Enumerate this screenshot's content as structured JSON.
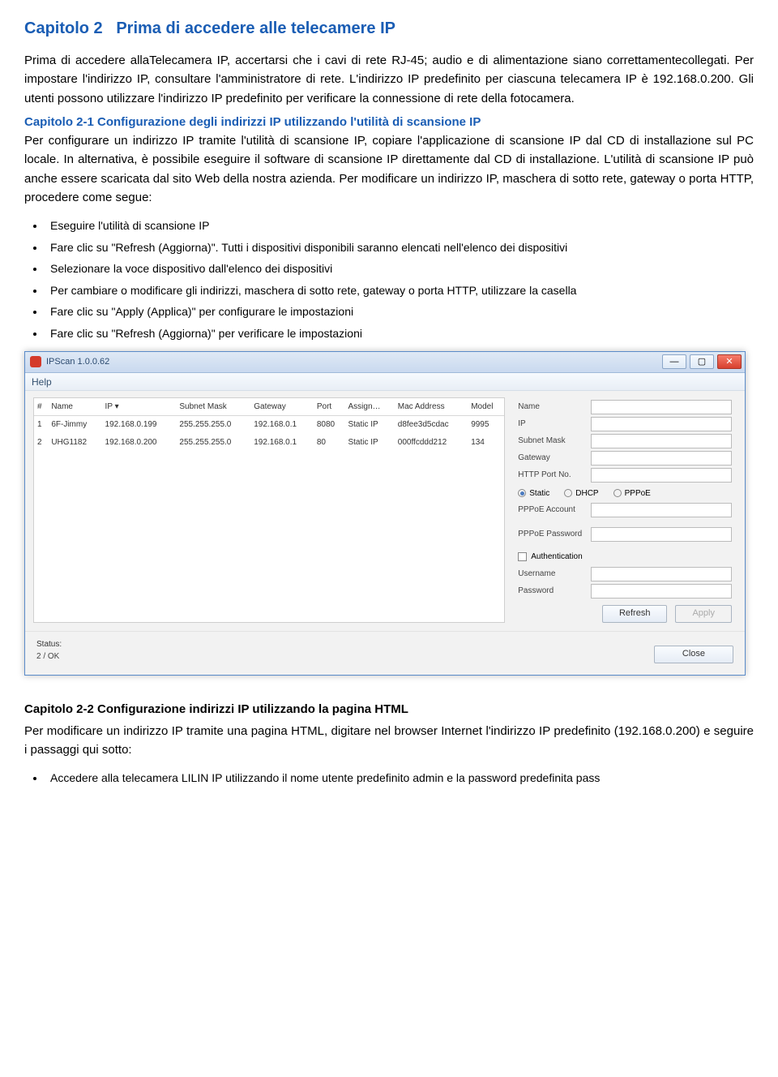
{
  "chapter": {
    "title": "Capitolo 2   Prima di accedere alle telecamere IP",
    "para1": "Prima di accedere allaTelecamera IP, accertarsi che i cavi di rete RJ-45; audio e di alimentazione siano correttamentecollegati. Per impostare l'indirizzo IP, consultare l'amministratore di rete. L'indirizzo IP predefinito per ciascuna telecamera IP è 192.168.0.200. Gli utenti possono utilizzare l'indirizzo IP predefinito per verificare la connessione di rete della fotocamera.",
    "sub1_title": "Capitolo 2-1 Configurazione degli indirizzi IP utilizzando l'utilità di scansione IP",
    "sub1_text": "Per configurare un indirizzo IP tramite l'utilità di scansione IP, copiare l'applicazione di scansione IP dal CD di installazione sul PC locale. In alternativa, è possibile eseguire il software di scansione IP direttamente dal CD di installazione. L'utilità di scansione IP può anche essere scaricata dal sito Web della nostra azienda. Per modificare un indirizzo IP, maschera di sotto rete, gateway o porta HTTP, procedere come segue:",
    "bullets1": [
      "Eseguire l'utilità di scansione IP",
      "Fare clic su \"Refresh (Aggiorna)\". Tutti i dispositivi disponibili saranno elencati nell'elenco dei dispositivi",
      "Selezionare la voce dispositivo dall'elenco dei dispositivi",
      "Per cambiare o modificare gli indirizzi, maschera di sotto rete, gateway o porta HTTP, utilizzare la casella",
      "Fare clic su \"Apply (Applica)\" per configurare le impostazioni",
      "Fare clic su \"Refresh (Aggiorna)\" per verificare le impostazioni"
    ]
  },
  "app": {
    "title": "IPScan 1.0.0.62",
    "menu": "Help",
    "cols": {
      "num": "#",
      "name": "Name",
      "ip": "IP",
      "mask": "Subnet Mask",
      "gw": "Gateway",
      "port": "Port",
      "assign": "Assign…",
      "mac": "Mac Address",
      "model": "Model"
    },
    "rows": [
      {
        "num": "1",
        "name": "6F-Jimmy",
        "ip": "192.168.0.199",
        "mask": "255.255.255.0",
        "gw": "192.168.0.1",
        "port": "8080",
        "assign": "Static IP",
        "mac": "d8fee3d5cdac",
        "model": "9995"
      },
      {
        "num": "2",
        "name": "UHG1182",
        "ip": "192.168.0.200",
        "mask": "255.255.255.0",
        "gw": "192.168.0.1",
        "port": "80",
        "assign": "Static IP",
        "mac": "000ffcddd212",
        "model": "134"
      }
    ],
    "labels": {
      "name": "Name",
      "ip": "IP",
      "mask": "Subnet Mask",
      "gw": "Gateway",
      "http": "HTTP Port No.",
      "static": "Static",
      "dhcp": "DHCP",
      "pppoe": "PPPoE",
      "pppoe_acc": "PPPoE Account",
      "pppoe_pwd": "PPPoE Password",
      "auth": "Authentication",
      "user": "Username",
      "pwd": "Password",
      "refresh": "Refresh",
      "apply": "Apply",
      "close": "Close"
    },
    "status_label": "Status:",
    "status_value": "2 / OK"
  },
  "chapter2": {
    "title": "Capitolo 2-2 Configurazione indirizzi IP utilizzando la pagina HTML",
    "text": "Per modificare un indirizzo IP tramite una pagina HTML, digitare nel browser Internet l'indirizzo IP predefinito (192.168.0.200) e seguire i passaggi qui sotto:",
    "bullet": "Accedere alla telecamera LILIN IP utilizzando il nome utente predefinito admin e la password predefinita pass"
  }
}
